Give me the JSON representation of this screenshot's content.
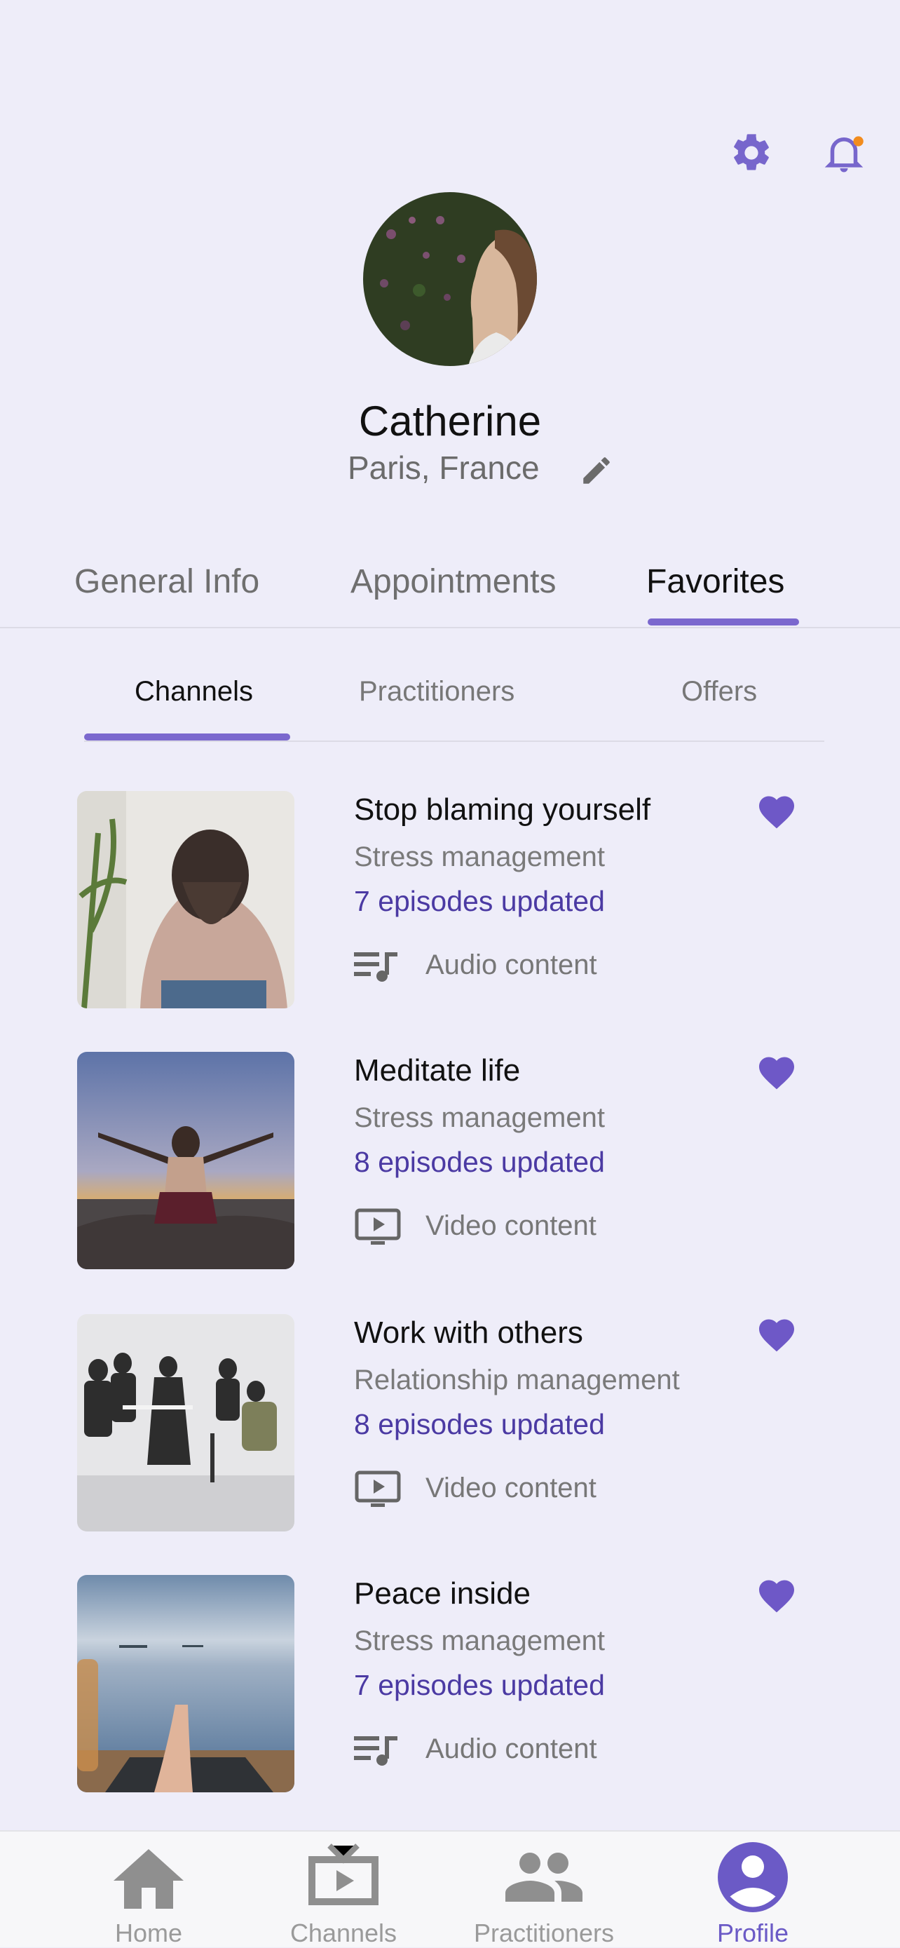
{
  "header": {
    "settings_icon": "gear-icon",
    "notifications_icon": "bell-icon",
    "notification_dot_color": "#F28C1E"
  },
  "profile": {
    "name": "Catherine",
    "location": "Paris, France",
    "edit_icon": "pencil-icon"
  },
  "tabs": {
    "primary": [
      {
        "label": "General Info",
        "active": false
      },
      {
        "label": "Appointments",
        "active": false
      },
      {
        "label": "Favorites",
        "active": true
      }
    ],
    "secondary": [
      {
        "label": "Channels",
        "active": true
      },
      {
        "label": "Practitioners",
        "active": false
      },
      {
        "label": "Offers",
        "active": false
      }
    ]
  },
  "favorites": [
    {
      "title": "Stop blaming yourself",
      "category": "Stress management",
      "episodes": "7 episodes updated",
      "content_type": "Audio content",
      "content_icon": "playlist-music-icon"
    },
    {
      "title": "Meditate life",
      "category": "Stress management",
      "episodes": "8 episodes updated",
      "content_type": "Video content",
      "content_icon": "video-play-icon"
    },
    {
      "title": "Work with others",
      "category": "Relationship management",
      "episodes": "8 episodes updated",
      "content_type": "Video content",
      "content_icon": "video-play-icon"
    },
    {
      "title": "Peace inside",
      "category": "Stress management",
      "episodes": "7 episodes updated",
      "content_type": "Audio content",
      "content_icon": "playlist-music-icon"
    }
  ],
  "bottom_nav": [
    {
      "label": "Home",
      "icon": "home-icon",
      "active": false
    },
    {
      "label": "Channels",
      "icon": "tv-icon",
      "active": false
    },
    {
      "label": "Practitioners",
      "icon": "people-icon",
      "active": false
    },
    {
      "label": "Profile",
      "icon": "profile-icon",
      "active": true
    }
  ],
  "colors": {
    "background": "#EEEDF9",
    "accent": "#7B68CE",
    "episodes_text": "#4B3AA3",
    "heart": "#6E58C7"
  }
}
